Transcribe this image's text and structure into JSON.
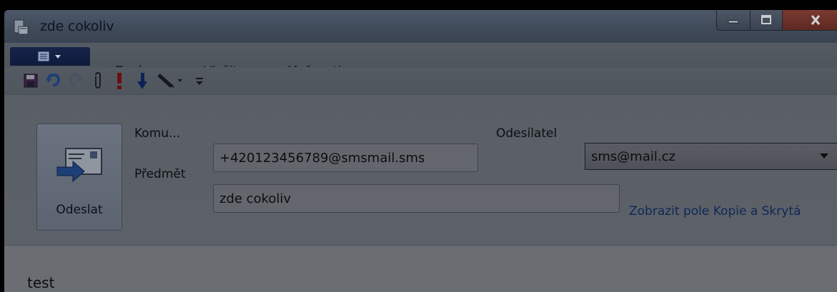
{
  "window": {
    "title": "zde cokoliv"
  },
  "ribbon": {
    "tabs": [
      {
        "label": "Zpráva"
      },
      {
        "label": "Vložit"
      },
      {
        "label": "Možnosti"
      }
    ]
  },
  "quick_access": {
    "icons": [
      "save-icon",
      "undo-icon",
      "redo-icon",
      "attach-icon",
      "high-importance-icon",
      "low-importance-icon",
      "signature-icon",
      "customize-toolbar-icon"
    ]
  },
  "compose": {
    "send_label": "Odeslat",
    "to_label": "Komu...",
    "to_value": "+420123456789@smsmail.sms",
    "from_label": "Odesílatel",
    "from_value": "sms@mail.cz",
    "subject_label": "Předmět",
    "subject_value": "zde cokoliv",
    "cc_link": "Zobrazit pole Kopie a Skrytá",
    "body": "test"
  }
}
